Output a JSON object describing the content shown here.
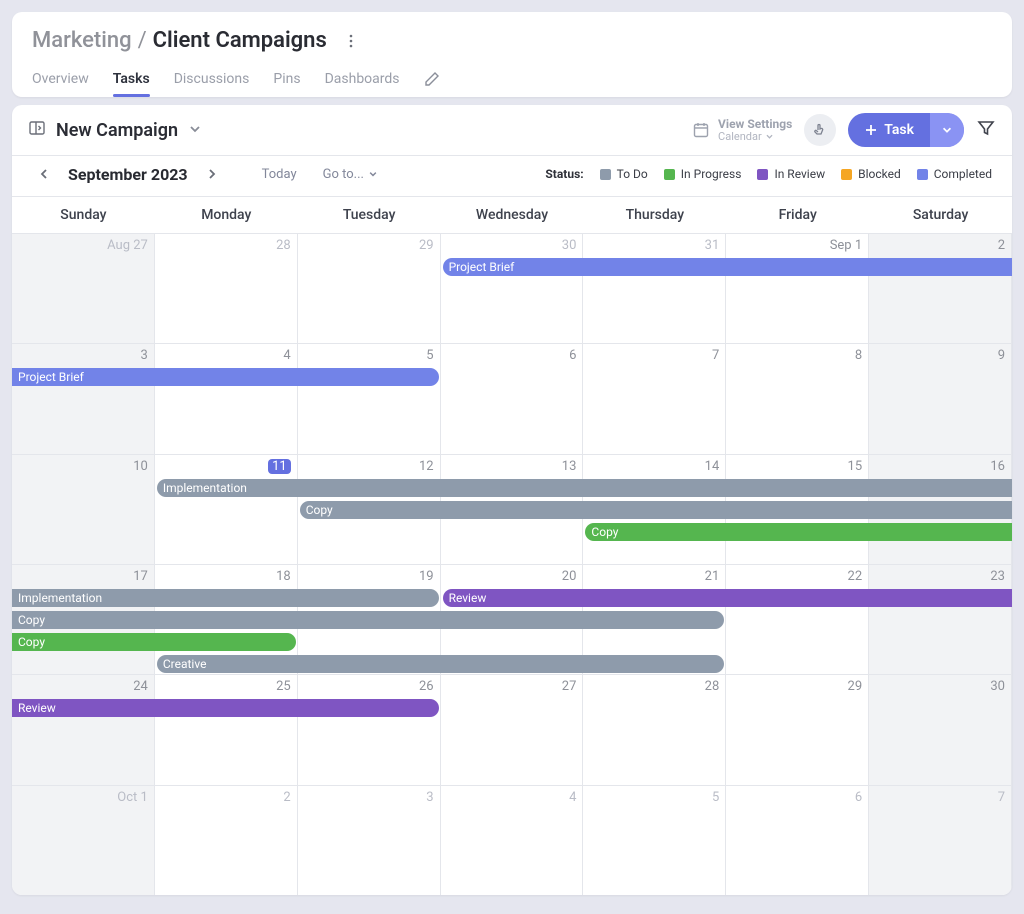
{
  "breadcrumb": {
    "parent": "Marketing",
    "separator": "/",
    "title": "Client Campaigns"
  },
  "tabs": [
    "Overview",
    "Tasks",
    "Discussions",
    "Pins",
    "Dashboards"
  ],
  "active_tab": "Tasks",
  "toolbar": {
    "campaign_name": "New Campaign",
    "view_settings_label": "View Settings",
    "view_mode": "Calendar",
    "task_button": "Task"
  },
  "subbar": {
    "month": "September 2023",
    "today": "Today",
    "goto": "Go to..."
  },
  "legend": {
    "label": "Status:",
    "items": [
      {
        "name": "To Do",
        "color": "#8e9bab"
      },
      {
        "name": "In Progress",
        "color": "#55b64f"
      },
      {
        "name": "In Review",
        "color": "#7f55c2"
      },
      {
        "name": "Blocked",
        "color": "#f5a623"
      },
      {
        "name": "Completed",
        "color": "#7283e8"
      }
    ]
  },
  "dow": [
    "Sunday",
    "Monday",
    "Tuesday",
    "Wednesday",
    "Thursday",
    "Friday",
    "Saturday"
  ],
  "weeks": [
    {
      "cells": [
        {
          "label": "Aug 27",
          "outside": true,
          "wknd": true
        },
        {
          "label": "28",
          "outside": true
        },
        {
          "label": "29",
          "outside": true
        },
        {
          "label": "30",
          "outside": true
        },
        {
          "label": "31",
          "outside": true
        },
        {
          "label": "Sep 1"
        },
        {
          "label": "2",
          "wknd": true
        }
      ],
      "events": [
        {
          "title": "Project Brief",
          "status": "completed",
          "row": 0,
          "startCol": 3,
          "endCol": 7,
          "roundStart": true,
          "roundEnd": false
        }
      ]
    },
    {
      "cells": [
        {
          "label": "3",
          "wknd": true
        },
        {
          "label": "4"
        },
        {
          "label": "5"
        },
        {
          "label": "6"
        },
        {
          "label": "7"
        },
        {
          "label": "8"
        },
        {
          "label": "9",
          "wknd": true
        }
      ],
      "events": [
        {
          "title": "Project Brief",
          "status": "completed",
          "row": 0,
          "startCol": 0,
          "endCol": 3,
          "roundStart": false,
          "roundEnd": true
        }
      ]
    },
    {
      "cells": [
        {
          "label": "10",
          "wknd": true
        },
        {
          "label": "11",
          "today": true
        },
        {
          "label": "12"
        },
        {
          "label": "13"
        },
        {
          "label": "14"
        },
        {
          "label": "15"
        },
        {
          "label": "16",
          "wknd": true
        }
      ],
      "events": [
        {
          "title": "Implementation",
          "status": "todo",
          "row": 0,
          "startCol": 1,
          "endCol": 7,
          "roundStart": true,
          "roundEnd": false
        },
        {
          "title": "Copy",
          "status": "todo",
          "row": 1,
          "startCol": 2,
          "endCol": 7,
          "roundStart": true,
          "roundEnd": false
        },
        {
          "title": "Copy",
          "status": "progress",
          "row": 2,
          "startCol": 4,
          "endCol": 7,
          "roundStart": true,
          "roundEnd": false
        }
      ]
    },
    {
      "cells": [
        {
          "label": "17",
          "wknd": true
        },
        {
          "label": "18"
        },
        {
          "label": "19"
        },
        {
          "label": "20"
        },
        {
          "label": "21"
        },
        {
          "label": "22"
        },
        {
          "label": "23",
          "wknd": true
        }
      ],
      "events": [
        {
          "title": "Implementation",
          "status": "todo",
          "row": 0,
          "startCol": 0,
          "endCol": 3,
          "roundStart": false,
          "roundEnd": true
        },
        {
          "title": "Review",
          "status": "review",
          "row": 0,
          "startCol": 3,
          "endCol": 7,
          "roundStart": true,
          "roundEnd": false
        },
        {
          "title": "Copy",
          "status": "todo",
          "row": 1,
          "startCol": 0,
          "endCol": 5,
          "roundStart": false,
          "roundEnd": true
        },
        {
          "title": "Copy",
          "status": "progress",
          "row": 2,
          "startCol": 0,
          "endCol": 2,
          "roundStart": false,
          "roundEnd": true
        },
        {
          "title": "Creative",
          "status": "todo",
          "row": 3,
          "startCol": 1,
          "endCol": 5,
          "roundStart": true,
          "roundEnd": true
        }
      ]
    },
    {
      "cells": [
        {
          "label": "24",
          "wknd": true
        },
        {
          "label": "25"
        },
        {
          "label": "26"
        },
        {
          "label": "27"
        },
        {
          "label": "28"
        },
        {
          "label": "29"
        },
        {
          "label": "30",
          "wknd": true
        }
      ],
      "events": [
        {
          "title": "Review",
          "status": "review",
          "row": 0,
          "startCol": 0,
          "endCol": 3,
          "roundStart": false,
          "roundEnd": true
        }
      ]
    },
    {
      "cells": [
        {
          "label": "Oct 1",
          "outside": true,
          "wknd": true
        },
        {
          "label": "2",
          "outside": true
        },
        {
          "label": "3",
          "outside": true
        },
        {
          "label": "4",
          "outside": true
        },
        {
          "label": "5",
          "outside": true
        },
        {
          "label": "6",
          "outside": true
        },
        {
          "label": "7",
          "outside": true,
          "wknd": true
        }
      ],
      "events": []
    }
  ],
  "status_colors": {
    "todo": "#8e9bab",
    "progress": "#55b64f",
    "review": "#7f55c2",
    "blocked": "#f5a623",
    "completed": "#7283e8"
  }
}
